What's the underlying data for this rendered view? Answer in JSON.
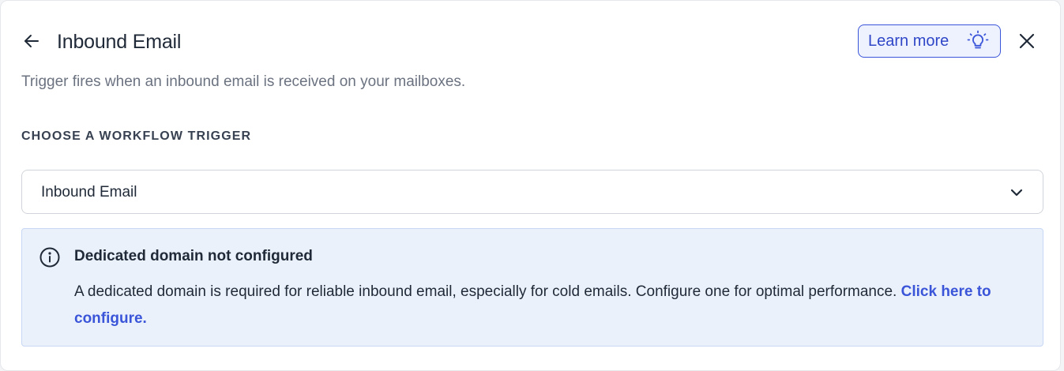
{
  "header": {
    "title": "Inbound Email",
    "back_icon": "arrow-left-icon",
    "close_icon": "close-icon",
    "learn_more": {
      "label": "Learn more",
      "icon": "lightbulb-icon"
    }
  },
  "description": "Trigger fires when an inbound email is received on your mailboxes.",
  "trigger_section": {
    "label": "CHOOSE A WORKFLOW TRIGGER",
    "selected_value": "Inbound Email",
    "dropdown_icon": "chevron-down-icon"
  },
  "alert": {
    "icon": "info-icon",
    "title": "Dedicated domain not configured",
    "body": "A dedicated domain is required for reliable inbound email, especially for cold emails. Configure one for optimal performance.",
    "link_label": "Click here to configure."
  },
  "colors": {
    "accent": "#3b55d9",
    "alert_background": "#eaf1fb",
    "alert_border": "#c7d7f5",
    "learn_more_background": "#eef2ff"
  }
}
